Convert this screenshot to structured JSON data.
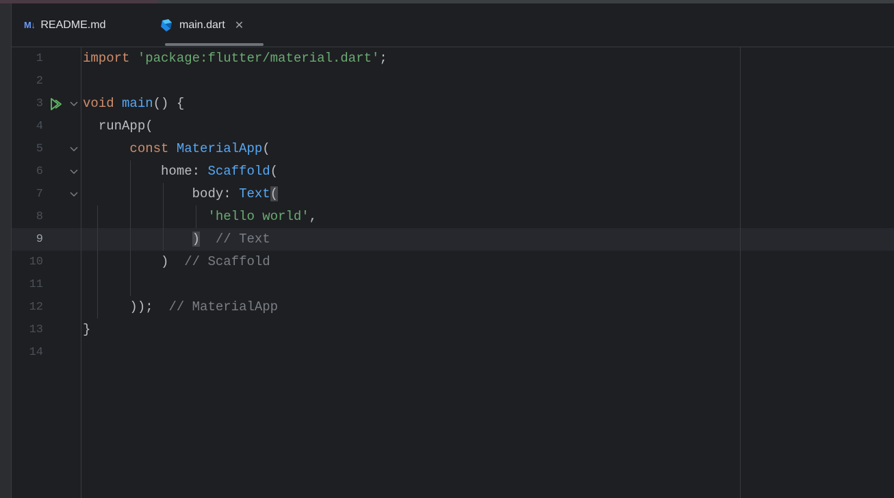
{
  "tabs": [
    {
      "icon": "markdown-icon",
      "icon_text": "M↓",
      "label": "README.md",
      "active": false
    },
    {
      "icon": "dart-icon",
      "label": "main.dart",
      "active": true,
      "close": "✕"
    }
  ],
  "colors": {
    "background": "#1e1f22",
    "keyword": "#cf8e6d",
    "string": "#6aab73",
    "function": "#56a8f5",
    "comment": "#7a7e85",
    "text": "#bcbec4",
    "run": "#5fb865"
  },
  "current_line": 9,
  "lines": [
    {
      "n": "1",
      "indent": "",
      "tokens": [
        {
          "t": "import",
          "c": "kw"
        },
        {
          "t": " ",
          "c": ""
        },
        {
          "t": "'package:flutter/material.dart'",
          "c": "str"
        },
        {
          "t": ";",
          "c": ""
        }
      ]
    },
    {
      "n": "2",
      "indent": "",
      "tokens": []
    },
    {
      "n": "3",
      "indent": "",
      "tokens": [
        {
          "t": "void",
          "c": "kw"
        },
        {
          "t": " ",
          "c": ""
        },
        {
          "t": "main",
          "c": "fn"
        },
        {
          "t": "() {",
          "c": ""
        }
      ]
    },
    {
      "n": "4",
      "indent": "  ",
      "tokens": [
        {
          "t": "runApp(",
          "c": ""
        }
      ]
    },
    {
      "n": "5",
      "indent": "      ",
      "tokens": [
        {
          "t": "const",
          "c": "kw"
        },
        {
          "t": " ",
          "c": ""
        },
        {
          "t": "MaterialApp",
          "c": "cls"
        },
        {
          "t": "(",
          "c": ""
        }
      ]
    },
    {
      "n": "6",
      "indent": "          ",
      "tokens": [
        {
          "t": "home: ",
          "c": ""
        },
        {
          "t": "Scaffold",
          "c": "cls"
        },
        {
          "t": "(",
          "c": ""
        }
      ]
    },
    {
      "n": "7",
      "indent": "              ",
      "tokens": [
        {
          "t": "body: ",
          "c": ""
        },
        {
          "t": "Text",
          "c": "cls"
        },
        {
          "t": "(",
          "c": "hl"
        }
      ]
    },
    {
      "n": "8",
      "indent": "                ",
      "tokens": [
        {
          "t": "'hello world'",
          "c": "str"
        },
        {
          "t": ",",
          "c": ""
        }
      ]
    },
    {
      "n": "9",
      "indent": "              ",
      "tokens": [
        {
          "t": ")",
          "c": "hl"
        },
        {
          "t": "  ",
          "c": ""
        },
        {
          "t": "// Text",
          "c": "cmt"
        }
      ]
    },
    {
      "n": "10",
      "indent": "          ",
      "tokens": [
        {
          "t": ")",
          "c": ""
        },
        {
          "t": "  ",
          "c": ""
        },
        {
          "t": "// Scaffold",
          "c": "cmt"
        }
      ]
    },
    {
      "n": "11",
      "indent": "",
      "tokens": []
    },
    {
      "n": "12",
      "indent": "      ",
      "tokens": [
        {
          "t": "));",
          "c": ""
        },
        {
          "t": "  ",
          "c": ""
        },
        {
          "t": "// MaterialApp",
          "c": "cmt"
        }
      ]
    },
    {
      "n": "13",
      "indent": "",
      "tokens": [
        {
          "t": "}",
          "c": ""
        }
      ]
    },
    {
      "n": "14",
      "indent": "",
      "tokens": []
    }
  ],
  "gutter_markers": {
    "run": [
      "3"
    ],
    "fold": [
      "3",
      "5",
      "6",
      "7"
    ]
  }
}
